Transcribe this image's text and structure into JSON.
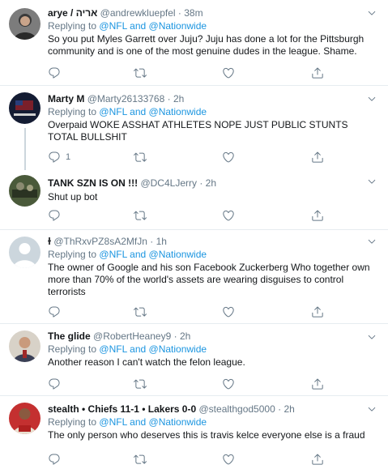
{
  "reply_prefix": "Replying to",
  "reply_targets": {
    "first": "@NFL",
    "joiner": "and",
    "second": "@Nationwide"
  },
  "tweets": [
    {
      "name": "arye / אריה",
      "handle": "@andrewkluepfel",
      "time": "38m",
      "text": "So you put Myles Garrett over Juju? Juju has done a lot for the Pittsburgh community and is one of the most genuine dudes in the league. Shame.",
      "reply_count": "",
      "avatar_color": "#7a7a7a"
    },
    {
      "name": "Marty M",
      "handle": "@Marty26133768",
      "time": "2h",
      "text": "Overpaid WOKE ASSHAT ATHLETES NOPE JUST PUBLIC STUNTS TOTAL BULLSHIT",
      "reply_count": "1",
      "avatar_color": "#1a2440"
    },
    {
      "name": "TANK SZN IS ON !!!",
      "handle": "@DC4LJerry",
      "time": "2h",
      "text": "Shut up bot",
      "reply_count": "",
      "avatar_color": "#3c4a30"
    },
    {
      "name": "ɫ",
      "handle": "@ThRxvPZ8sA2MfJn",
      "time": "1h",
      "text": "The owner  of Google and his son Facebook Zuckerberg Who together own more than 70% of the world's assets  are wearing  disguises  to  control terrorists",
      "reply_count": "",
      "avatar_color": "#ccd6dd"
    },
    {
      "name": "The glide",
      "handle": "@RobertHeaney9",
      "time": "2h",
      "text": "Another reason I can't watch the felon league.",
      "reply_count": "",
      "avatar_color": "#c9b9a8"
    },
    {
      "name": "stealth • Chiefs 11-1 • Lakers 0-0",
      "handle": "@stealthgod5000",
      "time": "2h",
      "text": "The only person who deserves this is travis kelce everyone else is a fraud",
      "reply_count": "",
      "avatar_color": "#b22a2a"
    }
  ],
  "dot": "·"
}
